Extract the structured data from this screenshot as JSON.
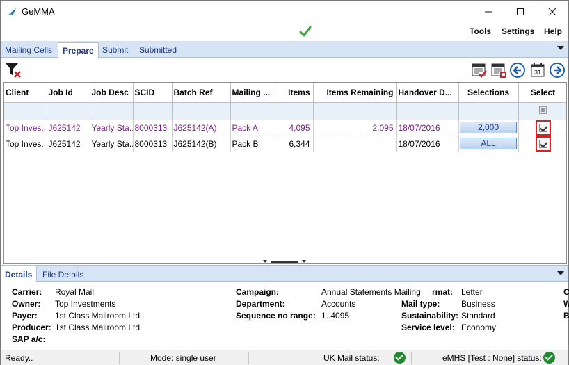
{
  "window": {
    "title": "GeMMA"
  },
  "menu": {
    "items": [
      "Tools",
      "Settings",
      "Help"
    ]
  },
  "tabs": [
    "Mailing Cells",
    "Prepare",
    "Submit",
    "Submitted"
  ],
  "active_tab": "Prepare",
  "grid": {
    "columns": [
      "Client",
      "Job Id",
      "Job Desc",
      "SCID",
      "Batch Ref",
      "Mailing ...",
      "Items",
      "Items Remaining",
      "Handover D...",
      "Selections",
      "Select"
    ],
    "rows": [
      {
        "client": "Top Inves...",
        "job_id": "J625142",
        "job_desc": "Yearly Sta...",
        "scid": "8000313",
        "batch_ref": "J625142(A)",
        "mailing": "Pack A",
        "items": "4,095",
        "items_remaining": "2,095",
        "handover": "18/07/2016",
        "selections": "2,000",
        "select": true
      },
      {
        "client": "Top Inves...",
        "job_id": "J625142",
        "job_desc": "Yearly Sta...",
        "scid": "8000313",
        "batch_ref": "J625142(B)",
        "mailing": "Pack B",
        "items": "6,344",
        "items_remaining": "",
        "handover": "18/07/2016",
        "selections": "ALL",
        "select": true
      }
    ]
  },
  "detail_tabs": [
    "Details",
    "File Details"
  ],
  "details": {
    "carrier_label": "Carrier:",
    "carrier": "Royal Mail",
    "owner_label": "Owner:",
    "owner": "Top Investments",
    "payer_label": "Payer:",
    "payer": "1st Class Mailroom Ltd",
    "producer_label": "Producer:",
    "producer": "1st Class Mailroom Ltd",
    "sap_label": "SAP a/c:",
    "sap": "",
    "campaign_label": "Campaign:",
    "campaign": "Annual Statements Mailing",
    "department_label": "Department:",
    "department": "Accounts",
    "seq_label": "Sequence no range:",
    "seq": "1..4095",
    "format_label": "rmat:",
    "format": "Letter",
    "mail_type_label": "Mail type:",
    "mail_type": "Business",
    "sustainability_label": "Sustainability:",
    "sustainability": "Standard",
    "service_label": "Service level:",
    "service": "Economy",
    "cut_labels": [
      "C",
      "W",
      "B"
    ]
  },
  "status": {
    "ready": "Ready..",
    "mode": "Mode: single user",
    "uk_mail": "UK Mail status:",
    "emhs": "eMHS [Test : None] status:"
  },
  "colors": {
    "accent": "#1b3a8c",
    "row_highlight": "#7a1f8c",
    "ok": "#1f8a2e"
  }
}
